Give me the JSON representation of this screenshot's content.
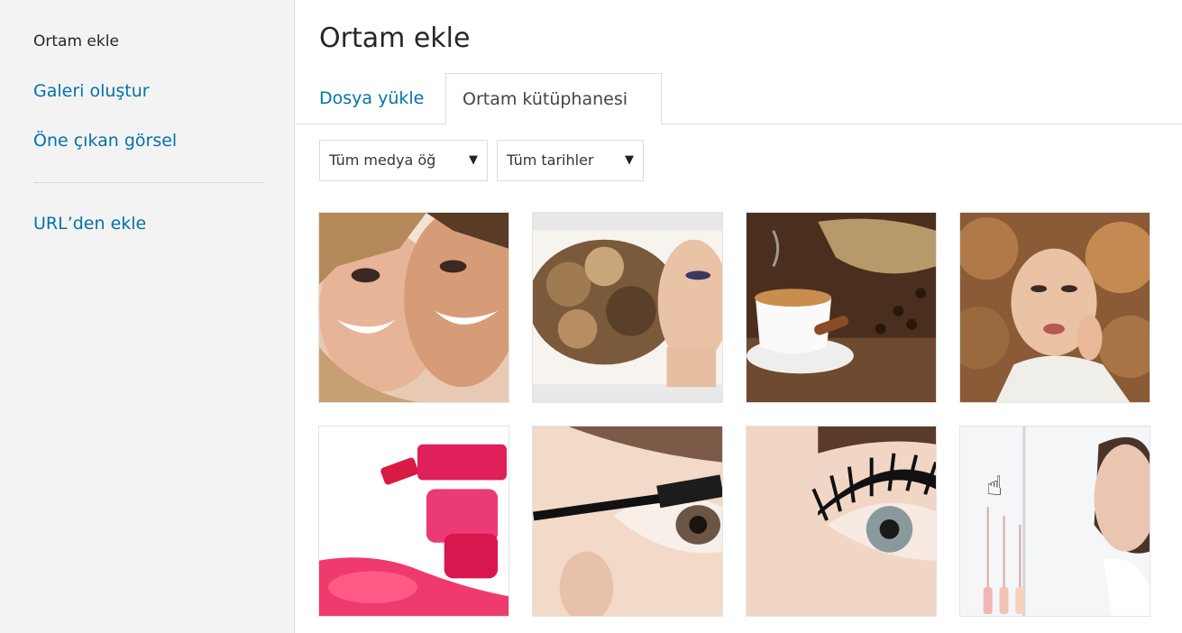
{
  "sidebar": {
    "items": [
      {
        "label": "Ortam ekle",
        "active": true
      },
      {
        "label": "Galeri oluştur"
      },
      {
        "label": "Öne çıkan görsel"
      },
      {
        "label": "URL’den ekle"
      }
    ]
  },
  "main": {
    "title": "Ortam ekle",
    "tabs": [
      {
        "label": "Dosya yükle"
      },
      {
        "label": "Ortam kütüphanesi",
        "selected": true
      }
    ],
    "filters": {
      "media_type": "Tüm medya öğ",
      "dates": "Tüm tarihler"
    }
  },
  "icons": {
    "dropdown": "caret-down-icon",
    "cursor": "hand-pointer-icon"
  },
  "colors": {
    "link": "#0073aa",
    "sidebar_bg": "#f3f3f3",
    "text": "#23282d"
  }
}
